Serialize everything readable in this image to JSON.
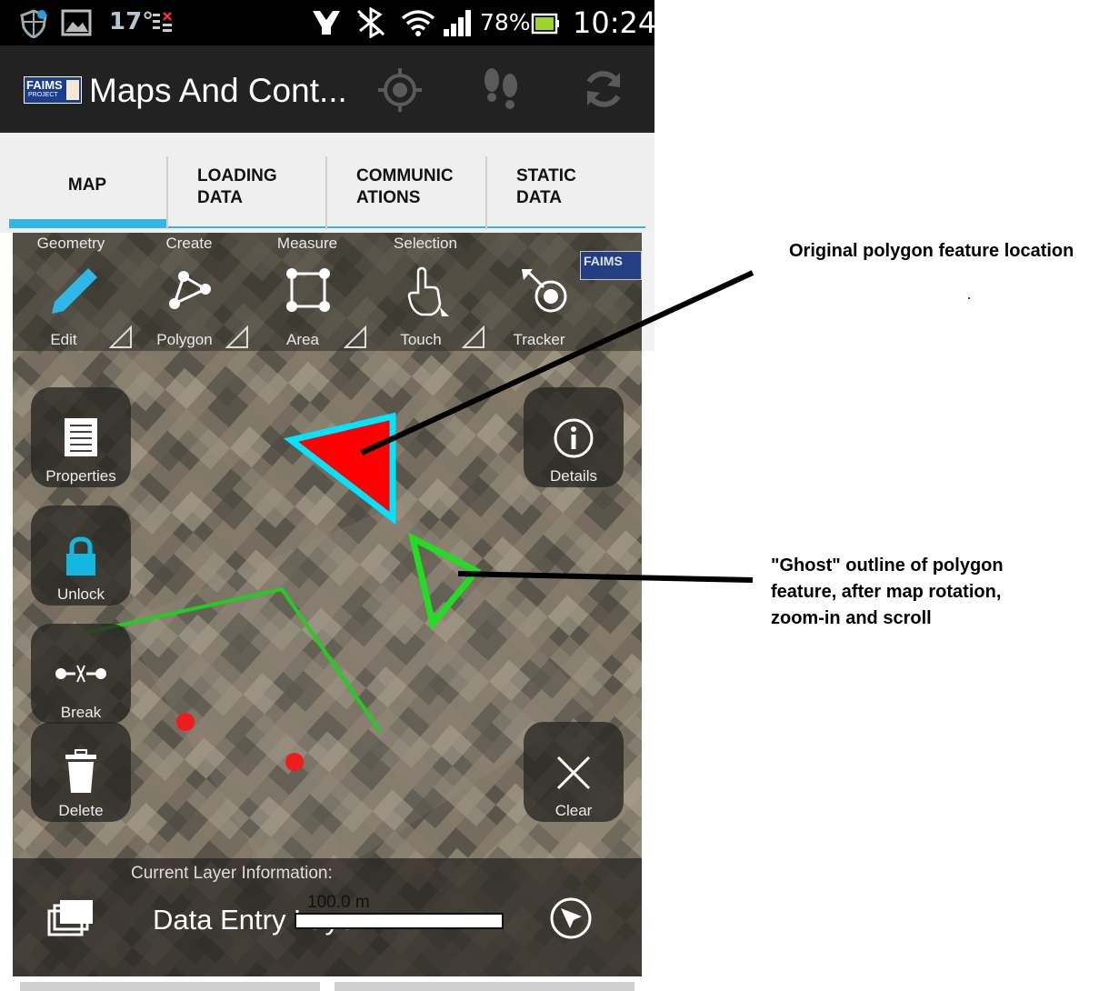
{
  "status_bar": {
    "temperature": "17°",
    "battery": "78%",
    "time": "10:24"
  },
  "action_bar": {
    "logo_text": "FAIMS",
    "logo_subtext": "PROJECT",
    "title": "Maps And Cont...",
    "icons": [
      "crosshair-icon",
      "footsteps-icon",
      "sync-icon"
    ]
  },
  "tabs": [
    {
      "label": "MAP",
      "selected": true
    },
    {
      "label": "LOADING\nDATA",
      "selected": false
    },
    {
      "label": "COMMUNIC\nATIONS",
      "selected": false
    },
    {
      "label": "STATIC\nDATA",
      "selected": false
    }
  ],
  "toolbar": {
    "categories": [
      "Geometry",
      "Create",
      "Measure",
      "Selection"
    ],
    "tools": [
      "Edit",
      "Polygon",
      "Area",
      "Touch",
      "Tracker"
    ],
    "watermark_logo": "FAIMS"
  },
  "left_buttons": [
    "Properties",
    "Unlock",
    "Break",
    "Delete"
  ],
  "right_buttons": [
    "Details",
    "Clear"
  ],
  "layer_info": {
    "header": "Current Layer Information:",
    "name": "Data Entry Layer",
    "scale": "100.0 m"
  },
  "annotations": {
    "original": "Original polygon feature location",
    "ghost_line1": "\"Ghost\" outline of polygon",
    "ghost_line2": "feature, after map rotation,",
    "ghost_line3": "zoom-in and scroll"
  },
  "colors": {
    "accent": "#33b5e5",
    "polygon_fill": "#ff0000",
    "polygon_outline": "#00e5ff",
    "ghost_outline": "#22dd22",
    "line": "#22cc22",
    "unlock_icon": "#13b8e0"
  }
}
